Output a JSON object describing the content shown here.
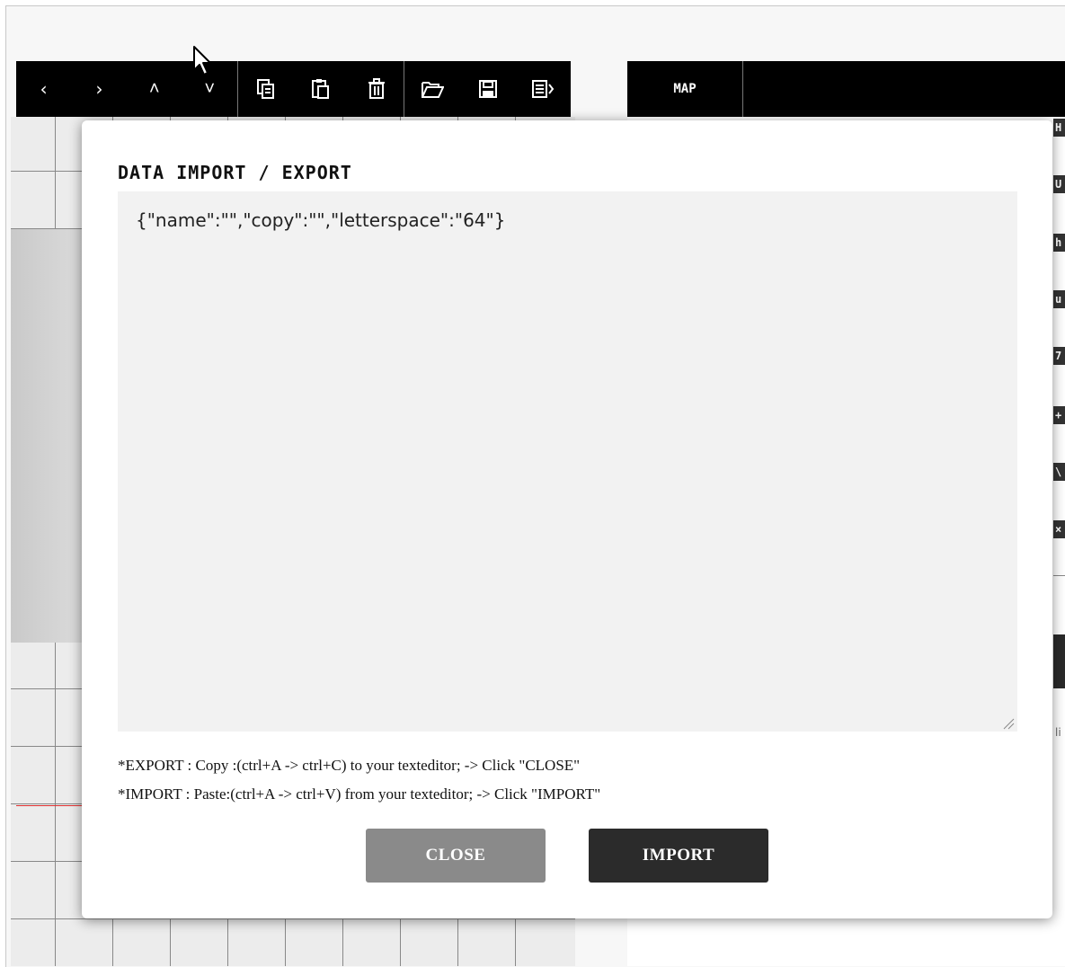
{
  "toolbar": {
    "nav": [
      "‹",
      "›",
      "˄",
      "˅"
    ],
    "tools": [
      {
        "icon": "copy-icon",
        "glyph": "⎘"
      },
      {
        "icon": "paste-icon",
        "glyph": "📋"
      },
      {
        "icon": "trash-icon",
        "glyph": "🗑"
      },
      {
        "icon": "folder-open-icon",
        "glyph": "📂"
      },
      {
        "icon": "save-icon",
        "glyph": "💾"
      },
      {
        "icon": "export-icon",
        "glyph": "🗎"
      }
    ]
  },
  "right_panel": {
    "tab_label": "MAP",
    "chips": [
      "H",
      "U",
      "h",
      "u",
      "7",
      "+",
      "\\",
      "×"
    ],
    "footer_text": "li"
  },
  "modal": {
    "title": "DATA IMPORT / EXPORT",
    "textarea_value": "{\"name\":\"\",\"copy\":\"\",\"letterspace\":\"64\"}",
    "help_export": "*EXPORT : Copy :(ctrl+A -> ctrl+C) to your texteditor; -> Click \"CLOSE\"",
    "help_import": "*IMPORT : Paste:(ctrl+A -> ctrl+V) from your texteditor; -> Click \"IMPORT\"",
    "close_label": "CLOSE",
    "import_label": "IMPORT"
  },
  "colors": {
    "toolbar_bg": "#000000",
    "close_button": "#8a8a8a",
    "import_button": "#2b2b2b",
    "textarea_bg": "#f2f2f2"
  }
}
